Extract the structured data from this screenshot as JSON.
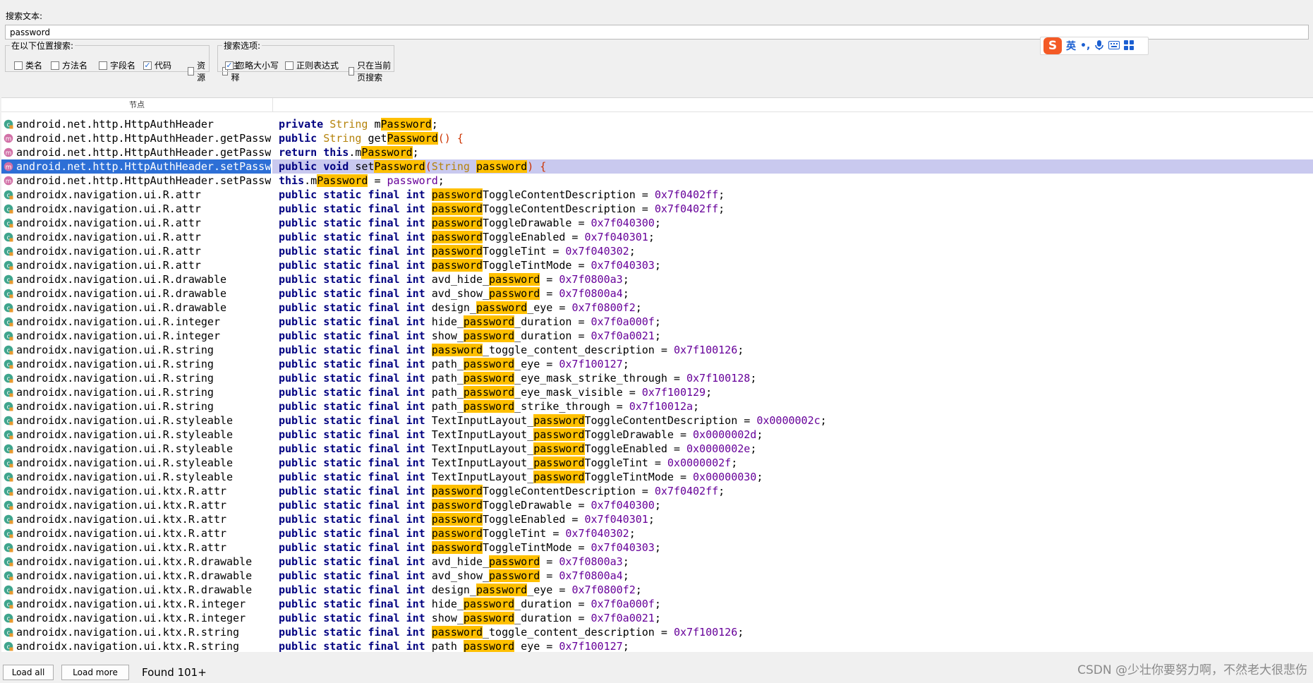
{
  "search": {
    "label": "搜索文本:",
    "value": "password"
  },
  "search_in": {
    "label": "在以下位置搜索:",
    "options": [
      {
        "label": "类名",
        "checked": false
      },
      {
        "label": "方法名",
        "checked": false
      },
      {
        "label": "字段名",
        "checked": false
      },
      {
        "label": "代码",
        "checked": true
      },
      {
        "label": "资源",
        "checked": false
      },
      {
        "label": "注释",
        "checked": false
      }
    ]
  },
  "search_opts": {
    "label": "搜索选项:",
    "options": [
      {
        "label": "忽略大小写",
        "checked": true
      },
      {
        "label": "正则表达式",
        "checked": false
      },
      {
        "label": "只在当前页搜索",
        "checked": false
      }
    ]
  },
  "ime": {
    "lang": "英",
    "punct": "•,",
    "items": [
      "sogou-logo-icon",
      "mic-icon",
      "keyboard-icon",
      "grid-icon"
    ]
  },
  "table": {
    "header": "节点",
    "selected_row": 3,
    "rows": [
      {
        "node": "android.net.http.HttpAuthHeader",
        "icon": "field",
        "code": [
          [
            "kw",
            "private "
          ],
          [
            "ty",
            "String "
          ],
          [
            "t",
            "m"
          ],
          [
            "hl",
            "Password"
          ],
          [
            "t",
            ";"
          ]
        ]
      },
      {
        "node": "android.net.http.HttpAuthHeader.getPassw",
        "icon": "method",
        "code": [
          [
            "kw",
            "public "
          ],
          [
            "ty",
            "String "
          ],
          [
            "t",
            "get"
          ],
          [
            "hl",
            "Password"
          ],
          [
            "pn",
            "() {"
          ]
        ]
      },
      {
        "node": "android.net.http.HttpAuthHeader.getPassw",
        "icon": "method",
        "code": [
          [
            "kw",
            "return "
          ],
          [
            "kw",
            "this"
          ],
          [
            "t",
            ".m"
          ],
          [
            "hl",
            "Password"
          ],
          [
            "t",
            ";"
          ]
        ]
      },
      {
        "node": "android.net.http.HttpAuthHeader.setPassw",
        "icon": "method",
        "code": [
          [
            "kw",
            "public "
          ],
          [
            "kw",
            "void "
          ],
          [
            "t",
            "set"
          ],
          [
            "hl",
            "Password"
          ],
          [
            "pn",
            "("
          ],
          [
            "ty",
            "String "
          ],
          [
            "hl",
            "password"
          ],
          [
            "pn",
            ") {"
          ]
        ]
      },
      {
        "node": "android.net.http.HttpAuthHeader.setPassw",
        "icon": "method",
        "code": [
          [
            "kw",
            "this"
          ],
          [
            "t",
            ".m"
          ],
          [
            "hl",
            "Password"
          ],
          [
            "t",
            " = "
          ],
          [
            "nm",
            "password"
          ],
          [
            "t",
            ";"
          ]
        ]
      },
      {
        "node": "androidx.navigation.ui.R.attr",
        "icon": "field",
        "code": [
          [
            "hl",
            "password"
          ],
          [
            "t",
            "ToggleContentDescription"
          ],
          [
            "t",
            " = "
          ],
          [
            "nm",
            "0x7f0402ff"
          ],
          [
            "t",
            ";"
          ]
        ]
      },
      {
        "node": "androidx.navigation.ui.R.attr",
        "icon": "field",
        "code": [
          [
            "hl",
            "password"
          ],
          [
            "t",
            "ToggleContentDescription"
          ],
          [
            "t",
            " = "
          ],
          [
            "nm",
            "0x7f0402ff"
          ],
          [
            "t",
            ";"
          ]
        ]
      },
      {
        "node": "androidx.navigation.ui.R.attr",
        "icon": "field",
        "code": [
          [
            "hl",
            "password"
          ],
          [
            "t",
            "ToggleDrawable"
          ],
          [
            "t",
            " = "
          ],
          [
            "nm",
            "0x7f040300"
          ],
          [
            "t",
            ";"
          ]
        ]
      },
      {
        "node": "androidx.navigation.ui.R.attr",
        "icon": "field",
        "code": [
          [
            "hl",
            "password"
          ],
          [
            "t",
            "ToggleEnabled"
          ],
          [
            "t",
            " = "
          ],
          [
            "nm",
            "0x7f040301"
          ],
          [
            "t",
            ";"
          ]
        ]
      },
      {
        "node": "androidx.navigation.ui.R.attr",
        "icon": "field",
        "code": [
          [
            "hl",
            "password"
          ],
          [
            "t",
            "ToggleTint"
          ],
          [
            "t",
            " = "
          ],
          [
            "nm",
            "0x7f040302"
          ],
          [
            "t",
            ";"
          ]
        ]
      },
      {
        "node": "androidx.navigation.ui.R.attr",
        "icon": "field",
        "code": [
          [
            "hl",
            "password"
          ],
          [
            "t",
            "ToggleTintMode"
          ],
          [
            "t",
            " = "
          ],
          [
            "nm",
            "0x7f040303"
          ],
          [
            "t",
            ";"
          ]
        ]
      },
      {
        "node": "androidx.navigation.ui.R.drawable",
        "icon": "field",
        "code": [
          [
            "t",
            "avd_hide_"
          ],
          [
            "hl",
            "password"
          ],
          [
            "t",
            " = "
          ],
          [
            "nm",
            "0x7f0800a3"
          ],
          [
            "t",
            ";"
          ]
        ]
      },
      {
        "node": "androidx.navigation.ui.R.drawable",
        "icon": "field",
        "code": [
          [
            "t",
            "avd_show_"
          ],
          [
            "hl",
            "password"
          ],
          [
            "t",
            " = "
          ],
          [
            "nm",
            "0x7f0800a4"
          ],
          [
            "t",
            ";"
          ]
        ]
      },
      {
        "node": "androidx.navigation.ui.R.drawable",
        "icon": "field",
        "code": [
          [
            "t",
            "design_"
          ],
          [
            "hl",
            "password"
          ],
          [
            "t",
            "_eye"
          ],
          [
            "t",
            " = "
          ],
          [
            "nm",
            "0x7f0800f2"
          ],
          [
            "t",
            ";"
          ]
        ]
      },
      {
        "node": "androidx.navigation.ui.R.integer",
        "icon": "field",
        "code": [
          [
            "t",
            "hide_"
          ],
          [
            "hl",
            "password"
          ],
          [
            "t",
            "_duration"
          ],
          [
            "t",
            " = "
          ],
          [
            "nm",
            "0x7f0a000f"
          ],
          [
            "t",
            ";"
          ]
        ]
      },
      {
        "node": "androidx.navigation.ui.R.integer",
        "icon": "field",
        "code": [
          [
            "t",
            "show_"
          ],
          [
            "hl",
            "password"
          ],
          [
            "t",
            "_duration"
          ],
          [
            "t",
            " = "
          ],
          [
            "nm",
            "0x7f0a0021"
          ],
          [
            "t",
            ";"
          ]
        ]
      },
      {
        "node": "androidx.navigation.ui.R.string",
        "icon": "field",
        "code": [
          [
            "hl",
            "password"
          ],
          [
            "t",
            "_toggle_content_description"
          ],
          [
            "t",
            " = "
          ],
          [
            "nm",
            "0x7f100126"
          ],
          [
            "t",
            ";"
          ]
        ]
      },
      {
        "node": "androidx.navigation.ui.R.string",
        "icon": "field",
        "code": [
          [
            "t",
            "path_"
          ],
          [
            "hl",
            "password"
          ],
          [
            "t",
            "_eye"
          ],
          [
            "t",
            " = "
          ],
          [
            "nm",
            "0x7f100127"
          ],
          [
            "t",
            ";"
          ]
        ]
      },
      {
        "node": "androidx.navigation.ui.R.string",
        "icon": "field",
        "code": [
          [
            "t",
            "path_"
          ],
          [
            "hl",
            "password"
          ],
          [
            "t",
            "_eye_mask_strike_through"
          ],
          [
            "t",
            " = "
          ],
          [
            "nm",
            "0x7f100128"
          ],
          [
            "t",
            ";"
          ]
        ]
      },
      {
        "node": "androidx.navigation.ui.R.string",
        "icon": "field",
        "code": [
          [
            "t",
            "path_"
          ],
          [
            "hl",
            "password"
          ],
          [
            "t",
            "_eye_mask_visible"
          ],
          [
            "t",
            " = "
          ],
          [
            "nm",
            "0x7f100129"
          ],
          [
            "t",
            ";"
          ]
        ]
      },
      {
        "node": "androidx.navigation.ui.R.string",
        "icon": "field",
        "code": [
          [
            "t",
            "path_"
          ],
          [
            "hl",
            "password"
          ],
          [
            "t",
            "_strike_through"
          ],
          [
            "t",
            " = "
          ],
          [
            "nm",
            "0x7f10012a"
          ],
          [
            "t",
            ";"
          ]
        ]
      },
      {
        "node": "androidx.navigation.ui.R.styleable",
        "icon": "field",
        "code": [
          [
            "t",
            "TextInputLayout_"
          ],
          [
            "hl",
            "password"
          ],
          [
            "t",
            "ToggleContentDescription"
          ],
          [
            "t",
            " = "
          ],
          [
            "nm",
            "0x0000002c"
          ],
          [
            "t",
            ";"
          ]
        ]
      },
      {
        "node": "androidx.navigation.ui.R.styleable",
        "icon": "field",
        "code": [
          [
            "t",
            "TextInputLayout_"
          ],
          [
            "hl",
            "password"
          ],
          [
            "t",
            "ToggleDrawable"
          ],
          [
            "t",
            " = "
          ],
          [
            "nm",
            "0x0000002d"
          ],
          [
            "t",
            ";"
          ]
        ]
      },
      {
        "node": "androidx.navigation.ui.R.styleable",
        "icon": "field",
        "code": [
          [
            "t",
            "TextInputLayout_"
          ],
          [
            "hl",
            "password"
          ],
          [
            "t",
            "ToggleEnabled"
          ],
          [
            "t",
            " = "
          ],
          [
            "nm",
            "0x0000002e"
          ],
          [
            "t",
            ";"
          ]
        ]
      },
      {
        "node": "androidx.navigation.ui.R.styleable",
        "icon": "field",
        "code": [
          [
            "t",
            "TextInputLayout_"
          ],
          [
            "hl",
            "password"
          ],
          [
            "t",
            "ToggleTint"
          ],
          [
            "t",
            " = "
          ],
          [
            "nm",
            "0x0000002f"
          ],
          [
            "t",
            ";"
          ]
        ]
      },
      {
        "node": "androidx.navigation.ui.R.styleable",
        "icon": "field",
        "code": [
          [
            "t",
            "TextInputLayout_"
          ],
          [
            "hl",
            "password"
          ],
          [
            "t",
            "ToggleTintMode"
          ],
          [
            "t",
            " = "
          ],
          [
            "nm",
            "0x00000030"
          ],
          [
            "t",
            ";"
          ]
        ]
      },
      {
        "node": "androidx.navigation.ui.ktx.R.attr",
        "icon": "field",
        "code": [
          [
            "hl",
            "password"
          ],
          [
            "t",
            "ToggleContentDescription"
          ],
          [
            "t",
            " = "
          ],
          [
            "nm",
            "0x7f0402ff"
          ],
          [
            "t",
            ";"
          ]
        ]
      },
      {
        "node": "androidx.navigation.ui.ktx.R.attr",
        "icon": "field",
        "code": [
          [
            "hl",
            "password"
          ],
          [
            "t",
            "ToggleDrawable"
          ],
          [
            "t",
            " = "
          ],
          [
            "nm",
            "0x7f040300"
          ],
          [
            "t",
            ";"
          ]
        ]
      },
      {
        "node": "androidx.navigation.ui.ktx.R.attr",
        "icon": "field",
        "code": [
          [
            "hl",
            "password"
          ],
          [
            "t",
            "ToggleEnabled"
          ],
          [
            "t",
            " = "
          ],
          [
            "nm",
            "0x7f040301"
          ],
          [
            "t",
            ";"
          ]
        ]
      },
      {
        "node": "androidx.navigation.ui.ktx.R.attr",
        "icon": "field",
        "code": [
          [
            "hl",
            "password"
          ],
          [
            "t",
            "ToggleTint"
          ],
          [
            "t",
            " = "
          ],
          [
            "nm",
            "0x7f040302"
          ],
          [
            "t",
            ";"
          ]
        ]
      },
      {
        "node": "androidx.navigation.ui.ktx.R.attr",
        "icon": "field",
        "code": [
          [
            "hl",
            "password"
          ],
          [
            "t",
            "ToggleTintMode"
          ],
          [
            "t",
            " = "
          ],
          [
            "nm",
            "0x7f040303"
          ],
          [
            "t",
            ";"
          ]
        ]
      },
      {
        "node": "androidx.navigation.ui.ktx.R.drawable",
        "icon": "field",
        "code": [
          [
            "t",
            "avd_hide_"
          ],
          [
            "hl",
            "password"
          ],
          [
            "t",
            " = "
          ],
          [
            "nm",
            "0x7f0800a3"
          ],
          [
            "t",
            ";"
          ]
        ]
      },
      {
        "node": "androidx.navigation.ui.ktx.R.drawable",
        "icon": "field",
        "code": [
          [
            "t",
            "avd_show_"
          ],
          [
            "hl",
            "password"
          ],
          [
            "t",
            " = "
          ],
          [
            "nm",
            "0x7f0800a4"
          ],
          [
            "t",
            ";"
          ]
        ]
      },
      {
        "node": "androidx.navigation.ui.ktx.R.drawable",
        "icon": "field",
        "code": [
          [
            "t",
            "design_"
          ],
          [
            "hl",
            "password"
          ],
          [
            "t",
            "_eye"
          ],
          [
            "t",
            " = "
          ],
          [
            "nm",
            "0x7f0800f2"
          ],
          [
            "t",
            ";"
          ]
        ]
      },
      {
        "node": "androidx.navigation.ui.ktx.R.integer",
        "icon": "field",
        "code": [
          [
            "t",
            "hide_"
          ],
          [
            "hl",
            "password"
          ],
          [
            "t",
            "_duration"
          ],
          [
            "t",
            " = "
          ],
          [
            "nm",
            "0x7f0a000f"
          ],
          [
            "t",
            ";"
          ]
        ]
      },
      {
        "node": "androidx.navigation.ui.ktx.R.integer",
        "icon": "field",
        "code": [
          [
            "t",
            "show_"
          ],
          [
            "hl",
            "password"
          ],
          [
            "t",
            "_duration"
          ],
          [
            "t",
            " = "
          ],
          [
            "nm",
            "0x7f0a0021"
          ],
          [
            "t",
            ";"
          ]
        ]
      },
      {
        "node": "androidx.navigation.ui.ktx.R.string",
        "icon": "field",
        "code": [
          [
            "hl",
            "password"
          ],
          [
            "t",
            "_toggle_content_description"
          ],
          [
            "t",
            " = "
          ],
          [
            "nm",
            "0x7f100126"
          ],
          [
            "t",
            ";"
          ]
        ]
      },
      {
        "node": "androidx.navigation.ui.ktx.R.string",
        "icon": "field",
        "code": [
          [
            "t",
            "path_"
          ],
          [
            "hl",
            "password"
          ],
          [
            "t",
            "_eye"
          ],
          [
            "t",
            " = "
          ],
          [
            "nm",
            "0x7f100127"
          ],
          [
            "t",
            ";"
          ]
        ]
      }
    ]
  },
  "field_prefix": "public static final int ",
  "footer": {
    "load_all": "Load all",
    "load_more": "Load more",
    "found": "Found 101+",
    "watermark": "CSDN @少壮你要努力啊，不然老大很悲伤"
  },
  "colors": {
    "keyword": "#000080",
    "type": "#b5830b",
    "number": "#660099",
    "highlight": "#ffc000",
    "selection": "#2d6fd6",
    "selection_code": "#c9c9ef"
  }
}
